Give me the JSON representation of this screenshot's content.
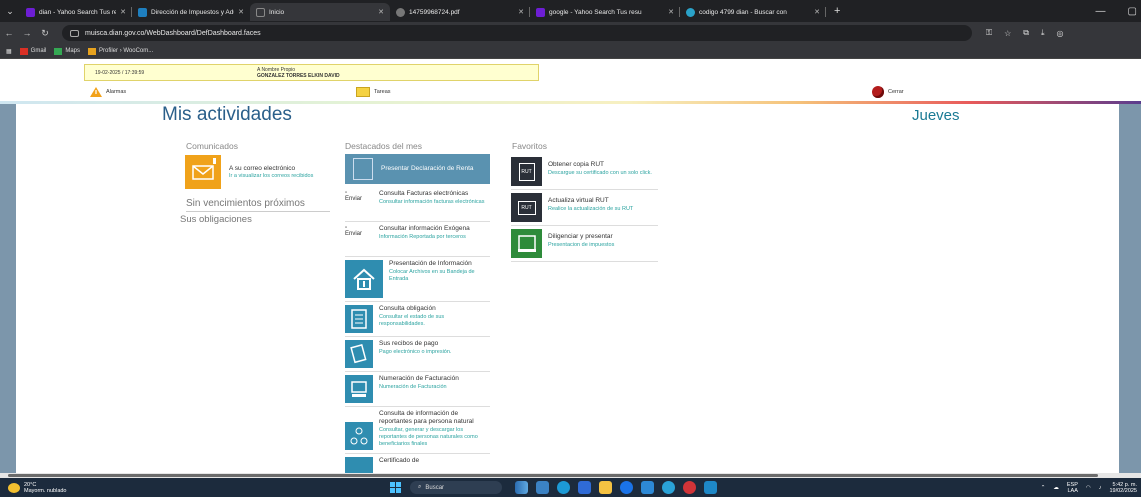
{
  "browser": {
    "tabs": [
      {
        "label": "dian - Yahoo Search Tus resulta",
        "color": "#6d1ed4"
      },
      {
        "label": "Dirección de Impuestos y Adua",
        "color": "#1e7fbf"
      },
      {
        "label": "Inicio",
        "color": "#666666"
      },
      {
        "label": "14759968724.pdf",
        "color": "#777777"
      },
      {
        "label": "google - Yahoo Search Tus resu",
        "color": "#6d1ed4"
      },
      {
        "label": "codigo 4799 dian - Buscar con",
        "color": "#2aa2c8"
      }
    ],
    "url": "muisca.dian.gov.co/WebDashboard/DefDashboard.faces",
    "bookmarks": [
      "Gmail",
      "Maps",
      "Profiler › WooCom..."
    ]
  },
  "header": {
    "datetime": "19-02-2025 / 17:39:59",
    "name_label": "A Nombre Propio",
    "name_value": "GONZALEZ TORRES ELKIN DAVID",
    "alarms": "Alarmas",
    "tasks": "Tareas",
    "close": "Cerrar"
  },
  "main": {
    "title": "Mis actividades",
    "day": "Jueves",
    "comunicados": {
      "title": "Comunicados",
      "card_title": "A su correo electrónico",
      "card_desc": "Ir a visualizar los correos recibidos"
    },
    "sin_vencimientos": "Sin vencimientos próximos",
    "sin_obligaciones": "Sus obligaciones",
    "destacados": {
      "title": "Destacados del mes",
      "featured": "Presentar Declaración de Renta",
      "items": [
        {
          "title": "Consulta Facturas electrónicas",
          "desc": "Consultar información facturas electrónicas",
          "broken": "Enviar"
        },
        {
          "title": "Consultar información Exógena",
          "desc": "Información Reportada por terceros",
          "broken": "Enviar"
        },
        {
          "title": "Presentación de Información",
          "desc": "Colocar Archivos en su Bandeja de Entrada"
        },
        {
          "title": "Consulta obligación",
          "desc": "Consultar el estado de sus responsabilidades."
        },
        {
          "title": "Sus recibos de pago",
          "desc": "Pago electrónico o impresión."
        },
        {
          "title": "Numeración de Facturación",
          "desc": "Numeración de Facturación"
        },
        {
          "title": "Consulta de información de reportantes para persona natural",
          "desc": "Consultar, generar y descargar los reportantes de personas naturales como beneficiarios finales"
        },
        {
          "title": "Certificado de",
          "desc": ""
        }
      ]
    },
    "favoritos": {
      "title": "Favoritos",
      "items": [
        {
          "title": "Obtener copia RUT",
          "desc": "Descargue su certificado con un solo click.",
          "badge": "RUT"
        },
        {
          "title": "Actualiza virtual RUT",
          "desc": "Realice la actualización de su RUT",
          "badge": "RUT"
        },
        {
          "title": "Diligenciar y presentar",
          "desc": "Presentacion de impuestos",
          "badge": ""
        }
      ]
    }
  },
  "taskbar": {
    "temp": "20°C",
    "weather": "Mayorm. nublado",
    "search": "Buscar",
    "lang": "ESP",
    "lang2": "LAA",
    "time": "5:42 p. m.",
    "date": "19/02/2025"
  }
}
